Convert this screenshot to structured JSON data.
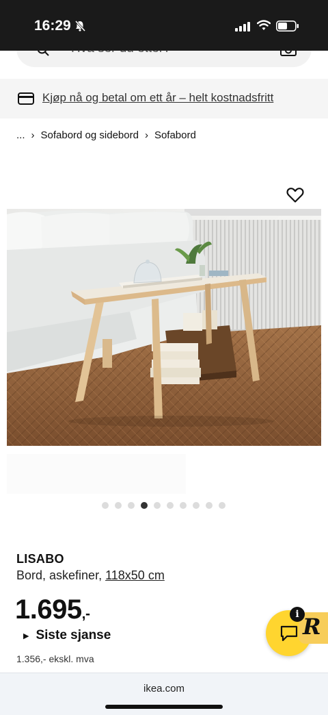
{
  "status_bar": {
    "time": "16:29"
  },
  "search": {
    "placeholder": "Hva ser du etter?"
  },
  "promo": {
    "text": "Kjøp nå og betal om ett år – helt kostnadsfritt"
  },
  "breadcrumb": {
    "ellipsis": "...",
    "items": [
      "Sofabord og sidebord",
      "Sofabord"
    ]
  },
  "carousel": {
    "total": 10,
    "active_index": 3
  },
  "product": {
    "name": "LISABO",
    "description": "Bord, askefiner,",
    "size": "118x50 cm",
    "price": "1.695",
    "price_suffix": ",-",
    "status": "Siste sjanse",
    "ex_vat": "1.356,- ekskl. mva"
  },
  "chat": {
    "info_badge": "i",
    "r_badge": "R"
  },
  "browser": {
    "url": "ikea.com"
  },
  "icons": [
    "bell-off-icon",
    "signal-icon",
    "wifi-icon",
    "battery-icon",
    "search-icon",
    "camera-icon",
    "card-icon",
    "chevron-right-icon",
    "heart-icon",
    "chat-icon",
    "info-icon",
    "triangle-right-icon"
  ],
  "colors": {
    "status_bar": "#1a1a1a",
    "chat_button": "#ffd52f",
    "promo_bg": "#f5f5f5",
    "dot_active": "#333333",
    "dot_inactive": "#dcdcdc"
  }
}
